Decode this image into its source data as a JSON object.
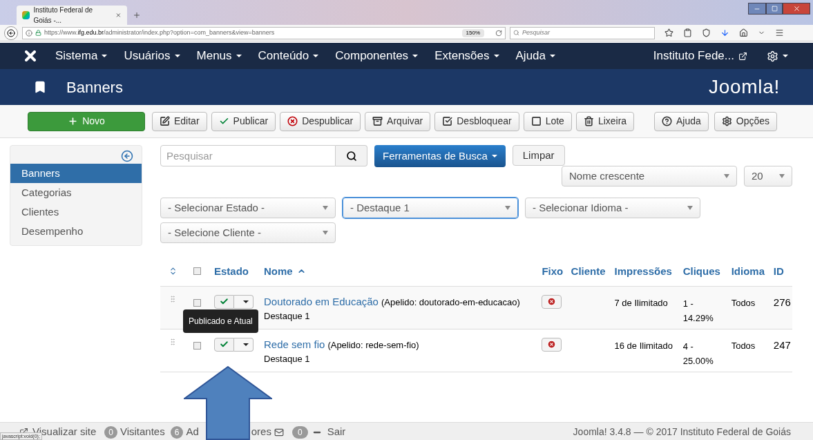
{
  "browser": {
    "tab_title": "Instituto Federal de Goiás -...",
    "url_prefix": "https://www.",
    "url_host": "ifg.edu.br",
    "url_path": "/administrator/index.php?option=com_banners&view=banners",
    "zoom": "150%",
    "search_placeholder": "Pesquisar"
  },
  "nav": {
    "menus": [
      "Sistema",
      "Usuários",
      "Menus",
      "Conteúdo",
      "Componentes",
      "Extensões",
      "Ajuda"
    ],
    "site": "Instituto Fede..."
  },
  "header": {
    "title": "Banners",
    "brand": "Joomla!"
  },
  "toolbar": [
    {
      "label": "Novo",
      "kind": "new"
    },
    {
      "label": "Editar",
      "kind": "edit"
    },
    {
      "label": "Publicar",
      "kind": "publish"
    },
    {
      "label": "Despublicar",
      "kind": "unpublish"
    },
    {
      "label": "Arquivar",
      "kind": "archive"
    },
    {
      "label": "Desbloquear",
      "kind": "checkin"
    },
    {
      "label": "Lote",
      "kind": "batch"
    },
    {
      "label": "Lixeira",
      "kind": "trash"
    },
    {
      "label": "Ajuda",
      "kind": "help"
    },
    {
      "label": "Opções",
      "kind": "options"
    }
  ],
  "sidebar": [
    {
      "label": "Banners",
      "selected": true
    },
    {
      "label": "Categorias",
      "selected": false
    },
    {
      "label": "Clientes",
      "selected": false
    },
    {
      "label": "Desempenho",
      "selected": false
    }
  ],
  "search": {
    "placeholder": "Pesquisar",
    "tools_button": "Ferramentas de Busca",
    "clear_button": "Limpar",
    "ordering": "Nome crescente",
    "limit": "20"
  },
  "filters": [
    {
      "value": "- Selecionar Estado -",
      "focused": false
    },
    {
      "value": "- Destaque 1",
      "focused": true
    },
    {
      "value": "- Selecionar Idioma -",
      "focused": false
    },
    {
      "value": "- Selecione Cliente -",
      "focused": false
    }
  ],
  "table": {
    "select_all_checked": false,
    "columns": [
      "Estado",
      "Nome",
      "Fixo",
      "Cliente",
      "Impressões",
      "Cliques",
      "Idioma",
      "ID"
    ],
    "rows": [
      {
        "checked": false,
        "name": "Doutorado em Educação",
        "alias": "(Apelido: doutorado-em-educacao)",
        "category": "Destaque 1",
        "published": true,
        "pinned": false,
        "impressions": "7 de Ilimitado",
        "clicks": "1 - 14.29%",
        "language": "Todos",
        "id": "276"
      },
      {
        "checked": false,
        "name": "Rede sem fio",
        "alias": "(Apelido: rede-sem-fio)",
        "category": "Destaque 1",
        "published": true,
        "pinned": false,
        "impressions": "16 de Ilimitado",
        "clicks": "4 - 25.00%",
        "language": "Todos",
        "id": "247"
      }
    ]
  },
  "tooltip": "Publicado e Atual",
  "footer": {
    "view_site": "Visualizar site",
    "visitors_count": "0",
    "visitors": "Visitantes",
    "admins_count": "6",
    "admins_start": "Ad",
    "admins_end": "ores",
    "messages_count": "0",
    "logout": "Sair",
    "version": "Joomla! 3.4.8 — © 2017 Instituto Federal de Goiás",
    "status_url": "javascript:void(0);"
  }
}
